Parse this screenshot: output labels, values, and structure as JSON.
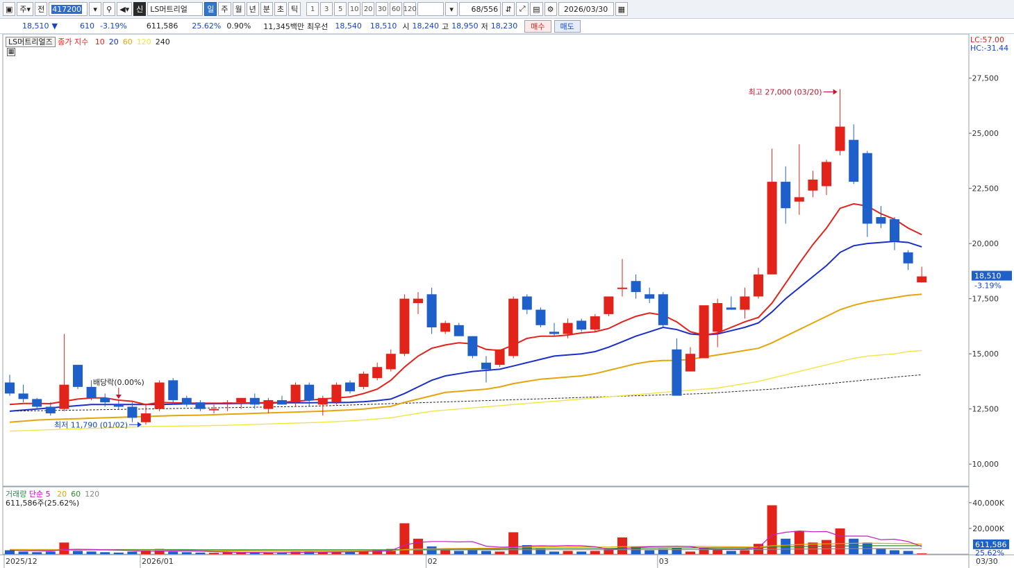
{
  "toolbar": {
    "market": "주",
    "jeon_label": "전",
    "stock_code": "417200",
    "credit_badge": "신",
    "stock_name": "LS머트리얼",
    "periods": [
      "일",
      "주",
      "월",
      "년",
      "분",
      "초",
      "틱"
    ],
    "active_period": "일",
    "intervals": [
      "1",
      "3",
      "5",
      "10",
      "20",
      "30",
      "60",
      "120"
    ],
    "bar_count": "68/556",
    "date": "2026/03/30"
  },
  "quote": {
    "price": "18,510",
    "change_arrow": "▼",
    "change": "610",
    "change_pct": "-3.19%",
    "volume": "611,586",
    "volume_ratio": "25.62%",
    "turnover": "0.90%",
    "value": "11,345백만",
    "best_bid_label": "최우선",
    "best_ask": "18,540",
    "best_bid": "18,510",
    "open_label": "시",
    "open": "18,240",
    "high_label": "고",
    "high": "18,950",
    "low_label": "저",
    "low": "18,230",
    "buy_label": "매수",
    "sell_label": "매도"
  },
  "main_legend": {
    "stock": "LS머트리얼즈",
    "index": "종가 지수",
    "ma": [
      {
        "label": "10",
        "color": "#e2231a"
      },
      {
        "label": "20",
        "color": "#1a2fc8"
      },
      {
        "label": "60",
        "color": "#e5a50a"
      },
      {
        "label": "120",
        "color": "#f2e640"
      },
      {
        "label": "240",
        "color": "#222222"
      }
    ],
    "lc": "LC:57.00",
    "hc": "HC:-31.44"
  },
  "volume_legend": {
    "title": "거래량",
    "ma_label": "단순 5",
    "ma": [
      {
        "label": "20",
        "color": "#e5a50a"
      },
      {
        "label": "60",
        "color": "#2e8b2e"
      },
      {
        "label": "120",
        "color": "#888888"
      }
    ],
    "current": "611,586주(25.62%)"
  },
  "annotations": {
    "high": "최고 27,000 (03/20)",
    "low": "최저 11,790 (01/02)",
    "dividend": "배당락(0.00%)"
  },
  "price_tag": {
    "price": "18,510",
    "pct": "-3.19%"
  },
  "volume_tag": {
    "volume": "611,586",
    "pct": "25.62%"
  },
  "colors": {
    "up": "#e2231a",
    "down": "#1f5fc9",
    "ma10": "#e2231a",
    "ma20": "#1a2fc8",
    "ma60": "#e5a50a",
    "ma120": "#f2e640",
    "ma240": "#222222"
  },
  "chart_data": {
    "type": "candlestick",
    "price_axis": {
      "min": 9000,
      "max": 29500,
      "ticks": [
        "10,000",
        "12,500",
        "15,000",
        "17,500",
        "20,000",
        "22,500",
        "25,000",
        "27,500"
      ],
      "tick_values": [
        10000,
        12500,
        15000,
        17500,
        20000,
        22500,
        25000,
        27500
      ]
    },
    "volume_axis": {
      "max": 48000,
      "ticks": [
        "20,000K",
        "40,000K"
      ],
      "tick_values": [
        20000,
        40000
      ]
    },
    "x_labels": [
      {
        "label": "2025/12",
        "index": 0
      },
      {
        "label": "2026/01",
        "index": 10
      },
      {
        "label": "02",
        "index": 31
      },
      {
        "label": "03",
        "index": 48
      }
    ],
    "last_date_label": "03/30",
    "candles": [
      [
        13700,
        14050,
        13100,
        13200
      ],
      [
        13200,
        13600,
        12800,
        12950
      ],
      [
        12950,
        13000,
        12500,
        12600
      ],
      [
        12600,
        12800,
        12200,
        12300
      ],
      [
        12500,
        15900,
        12400,
        13600
      ],
      [
        14500,
        14500,
        13400,
        13500
      ],
      [
        13500,
        13800,
        12900,
        13000
      ],
      [
        13000,
        13200,
        12600,
        12800
      ],
      [
        12700,
        12900,
        12500,
        12600
      ],
      [
        12600,
        12800,
        11900,
        12100
      ],
      [
        11900,
        12700,
        11790,
        12300
      ],
      [
        12500,
        13800,
        12400,
        13700
      ],
      [
        13800,
        13900,
        12700,
        12900
      ],
      [
        13000,
        13100,
        12600,
        12700
      ],
      [
        12800,
        12900,
        12400,
        12500
      ],
      [
        12500,
        12700,
        12300,
        12500
      ],
      [
        12800,
        12900,
        12400,
        12800
      ],
      [
        12800,
        13000,
        12500,
        13000
      ],
      [
        13000,
        13200,
        12500,
        12700
      ],
      [
        12500,
        13000,
        12300,
        12900
      ],
      [
        12900,
        13100,
        12700,
        12700
      ],
      [
        12800,
        13700,
        12600,
        13600
      ],
      [
        13600,
        13700,
        12600,
        12900
      ],
      [
        12700,
        13100,
        12200,
        13000
      ],
      [
        12800,
        13700,
        12700,
        13600
      ],
      [
        13700,
        13800,
        13200,
        13300
      ],
      [
        13500,
        14200,
        13400,
        14100
      ],
      [
        13900,
        14600,
        13800,
        14400
      ],
      [
        14300,
        15200,
        14200,
        15000
      ],
      [
        15000,
        17700,
        14900,
        17500
      ],
      [
        17300,
        17800,
        16800,
        17500
      ],
      [
        17700,
        18000,
        15900,
        16200
      ],
      [
        16000,
        16500,
        15900,
        16400
      ],
      [
        16300,
        16400,
        15800,
        15800
      ],
      [
        15800,
        15800,
        14800,
        14900
      ],
      [
        14600,
        14900,
        13700,
        14300
      ],
      [
        14500,
        15200,
        14400,
        15200
      ],
      [
        14900,
        17600,
        14800,
        17500
      ],
      [
        17600,
        17700,
        16800,
        17000
      ],
      [
        17000,
        17100,
        16200,
        16300
      ],
      [
        16000,
        16400,
        15800,
        15900
      ],
      [
        15900,
        16600,
        15700,
        16400
      ],
      [
        16500,
        16600,
        16000,
        16100
      ],
      [
        16100,
        16800,
        16000,
        16700
      ],
      [
        16800,
        17600,
        16700,
        17600
      ],
      [
        18000,
        19300,
        17600,
        18000
      ],
      [
        18300,
        18600,
        17500,
        17800
      ],
      [
        17700,
        18000,
        17300,
        17500
      ],
      [
        17700,
        17800,
        16200,
        16300
      ],
      [
        15200,
        15700,
        13100,
        13100
      ],
      [
        14200,
        15300,
        14200,
        15000
      ],
      [
        14800,
        17000,
        14800,
        17200
      ],
      [
        16000,
        17500,
        15300,
        17300
      ],
      [
        17100,
        17600,
        17000,
        17000
      ],
      [
        17000,
        18000,
        16600,
        17600
      ],
      [
        17600,
        18900,
        17500,
        18600
      ],
      [
        18600,
        24300,
        18600,
        22800
      ],
      [
        22800,
        23500,
        20900,
        21600
      ],
      [
        21900,
        24500,
        21300,
        22100
      ],
      [
        22400,
        23300,
        22100,
        22900
      ],
      [
        22600,
        23800,
        22200,
        23700
      ],
      [
        24200,
        27000,
        24000,
        25300
      ],
      [
        24700,
        25400,
        22700,
        22800
      ],
      [
        24100,
        24200,
        20300,
        20900
      ],
      [
        21200,
        21700,
        20700,
        20900
      ],
      [
        21100,
        21200,
        19700,
        20100
      ],
      [
        19600,
        19700,
        18800,
        19100
      ],
      [
        18240,
        18950,
        18230,
        18510
      ]
    ],
    "ma10": [
      12700,
      12750,
      12750,
      12740,
      12850,
      12950,
      13000,
      13000,
      12900,
      12850,
      12700,
      12800,
      12780,
      12770,
      12760,
      12760,
      12760,
      12770,
      12780,
      12790,
      12800,
      12850,
      12900,
      12950,
      13000,
      13050,
      13200,
      13400,
      13800,
      14400,
      14900,
      15250,
      15400,
      15500,
      15450,
      15200,
      15150,
      15400,
      15700,
      15800,
      15800,
      15850,
      15950,
      16000,
      16150,
      16450,
      16700,
      16850,
      16750,
      16450,
      16000,
      15850,
      15950,
      16200,
      16450,
      16650,
      17300,
      18200,
      19100,
      19950,
      20700,
      21600,
      21800,
      21700,
      21350,
      21100,
      20700,
      20400
    ],
    "ma20": [
      12400,
      12450,
      12500,
      12550,
      12600,
      12650,
      12700,
      12700,
      12700,
      12700,
      12700,
      12700,
      12720,
      12730,
      12730,
      12740,
      12740,
      12750,
      12760,
      12770,
      12780,
      12780,
      12780,
      12790,
      12790,
      12800,
      12830,
      12880,
      12950,
      13200,
      13500,
      13800,
      14000,
      14100,
      14200,
      14250,
      14300,
      14450,
      14600,
      14750,
      14900,
      14950,
      15000,
      15100,
      15300,
      15550,
      15800,
      16000,
      16200,
      16100,
      15900,
      15850,
      15900,
      16050,
      16200,
      16400,
      16900,
      17500,
      18000,
      18500,
      19000,
      19600,
      19900,
      20000,
      20050,
      20100,
      20050,
      19850
    ],
    "ma60": [
      11900,
      11950,
      12000,
      12020,
      12040,
      12060,
      12080,
      12100,
      12120,
      12140,
      12160,
      12180,
      12200,
      12210,
      12220,
      12240,
      12260,
      12280,
      12300,
      12320,
      12340,
      12360,
      12380,
      12400,
      12430,
      12460,
      12500,
      12560,
      12620,
      12800,
      12950,
      13100,
      13250,
      13300,
      13350,
      13400,
      13500,
      13650,
      13750,
      13850,
      13900,
      13950,
      14000,
      14100,
      14250,
      14400,
      14550,
      14650,
      14700,
      14700,
      14750,
      14850,
      14950,
      15050,
      15150,
      15250,
      15500,
      15800,
      16100,
      16400,
      16700,
      17000,
      17200,
      17350,
      17450,
      17550,
      17650,
      17700
    ],
    "ma120": [
      11500,
      11520,
      11540,
      11560,
      11580,
      11600,
      11620,
      11640,
      11660,
      11680,
      11700,
      11710,
      11720,
      11730,
      11740,
      11750,
      11760,
      11780,
      11800,
      11820,
      11840,
      11860,
      11880,
      11900,
      11930,
      11960,
      12000,
      12050,
      12100,
      12200,
      12300,
      12400,
      12450,
      12500,
      12550,
      12600,
      12650,
      12700,
      12750,
      12800,
      12850,
      12900,
      12950,
      13000,
      13050,
      13100,
      13150,
      13200,
      13250,
      13300,
      13350,
      13400,
      13450,
      13550,
      13650,
      13750,
      13900,
      14050,
      14200,
      14350,
      14500,
      14650,
      14800,
      14900,
      14950,
      15000,
      15100,
      15150
    ],
    "ma240": [
      12400,
      12410,
      12420,
      12430,
      12440,
      12450,
      12460,
      12470,
      12480,
      12490,
      12500,
      12510,
      12520,
      12530,
      12540,
      12550,
      12560,
      12570,
      12580,
      12590,
      12600,
      12610,
      12620,
      12640,
      12660,
      12680,
      12700,
      12720,
      12740,
      12760,
      12780,
      12800,
      12820,
      12840,
      12860,
      12880,
      12900,
      12920,
      12940,
      12960,
      12980,
      13000,
      13020,
      13040,
      13060,
      13080,
      13100,
      13120,
      13140,
      13160,
      13180,
      13200,
      13240,
      13280,
      13320,
      13360,
      13400,
      13460,
      13520,
      13580,
      13640,
      13700,
      13760,
      13820,
      13880,
      13940,
      14000,
      14050
    ],
    "volumes": [
      3000,
      2000,
      1500,
      2000,
      9000,
      2500,
      2000,
      1500,
      1200,
      2000,
      3000,
      4000,
      2000,
      1500,
      1200,
      1000,
      1500,
      1200,
      1500,
      1200,
      1000,
      1800,
      2000,
      1500,
      1800,
      2000,
      2500,
      3000,
      4000,
      24000,
      12000,
      6000,
      3000,
      2500,
      3000,
      2500,
      2000,
      17000,
      7000,
      4000,
      2000,
      2500,
      2000,
      2500,
      4000,
      13000,
      6000,
      3000,
      4000,
      5000,
      2000,
      5000,
      4000,
      2500,
      3000,
      8000,
      38000,
      12000,
      18000,
      9000,
      11000,
      20000,
      12000,
      9000,
      4000,
      3000,
      2500,
      611
    ],
    "volume_ma5": [
      3000,
      2800,
      2600,
      2500,
      3500,
      3800,
      3600,
      3400,
      3200,
      2800,
      2000,
      2300,
      2500,
      2500,
      2300,
      1900,
      1600,
      1300,
      1300,
      1200,
      1200,
      1300,
      1400,
      1500,
      1600,
      1800,
      2000,
      2300,
      2600,
      7100,
      9100,
      9800,
      9800,
      9500,
      9700,
      6200,
      5400,
      5600,
      6300,
      6500,
      6400,
      6700,
      6500,
      5700,
      3700,
      4200,
      5200,
      5700,
      6000,
      6200,
      5900,
      4200,
      4000,
      4000,
      4000,
      5000,
      15000,
      17000,
      18000,
      17400,
      17600,
      14000,
      14000,
      14000,
      11200,
      11600,
      9800,
      5900
    ],
    "volume_ma20": [
      3500,
      3500,
      3400,
      3400,
      3500,
      3500,
      3400,
      3300,
      3200,
      3100,
      3000,
      3000,
      2900,
      2800,
      2700,
      2600,
      2500,
      2400,
      2300,
      2200,
      2200,
      2200,
      2200,
      2200,
      2200,
      2200,
      2300,
      2400,
      2500,
      3500,
      4000,
      4200,
      4300,
      4400,
      4500,
      4600,
      4700,
      5300,
      5500,
      5600,
      5600,
      5600,
      5600,
      5500,
      5500,
      5800,
      5900,
      6000,
      6000,
      6000,
      6000,
      6000,
      5900,
      5700,
      5600,
      5400,
      6500,
      6900,
      7500,
      7800,
      8000,
      8200,
      8400,
      8500,
      8400,
      8300,
      8200,
      7800
    ],
    "volume_ma60": [
      3500,
      3500,
      3500,
      3500,
      3500,
      3500,
      3500,
      3500,
      3500,
      3500,
      3500,
      3500,
      3500,
      3500,
      3400,
      3400,
      3400,
      3400,
      3400,
      3400,
      3400,
      3400,
      3400,
      3400,
      3400,
      3400,
      3400,
      3400,
      3400,
      3700,
      3800,
      3900,
      3900,
      4000,
      4000,
      4000,
      4000,
      4300,
      4400,
      4400,
      4400,
      4400,
      4400,
      4400,
      4400,
      4600,
      4700,
      4700,
      4800,
      4800,
      4800,
      4900,
      4900,
      4900,
      4900,
      5000,
      5500,
      5700,
      5900,
      6000,
      6100,
      6300,
      6400,
      6500,
      6500,
      6500,
      6500,
      6500
    ],
    "volume_ma120": [
      3200,
      3200,
      3200,
      3200,
      3200,
      3200,
      3200,
      3200,
      3200,
      3200,
      3200,
      3200,
      3200,
      3200,
      3200,
      3200,
      3200,
      3200,
      3200,
      3200,
      3200,
      3200,
      3200,
      3200,
      3200,
      3200,
      3200,
      3200,
      3200,
      3300,
      3300,
      3300,
      3300,
      3300,
      3300,
      3300,
      3300,
      3400,
      3400,
      3400,
      3400,
      3400,
      3400,
      3400,
      3400,
      3500,
      3500,
      3500,
      3500,
      3500,
      3500,
      3500,
      3500,
      3500,
      3500,
      3600,
      3800,
      3900,
      4000,
      4000,
      4100,
      4200,
      4300,
      4300,
      4300,
      4300,
      4300,
      4300
    ]
  }
}
